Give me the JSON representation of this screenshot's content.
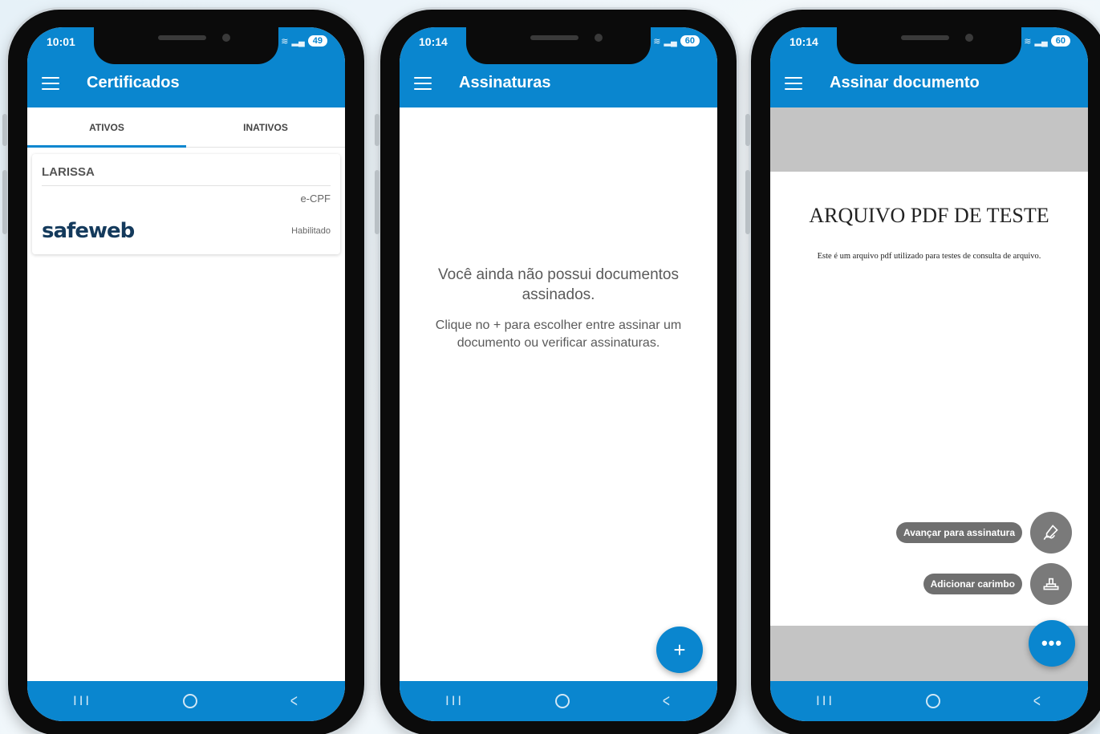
{
  "phones": [
    {
      "status_time": "10:01",
      "battery": "49",
      "title": "Certificados",
      "tabs": [
        "ATIVOS",
        "INATIVOS"
      ],
      "active_tab": "ATIVOS",
      "certificate": {
        "name": "LARISSA",
        "type": "e-CPF",
        "issuer_logo_text": "safeweb",
        "status": "Habilitado"
      }
    },
    {
      "status_time": "10:14",
      "battery": "60",
      "title": "Assinaturas",
      "empty_title": "Você ainda não possui documentos assinados.",
      "empty_hint": "Clique no + para escolher entre assinar um documento ou verificar assinaturas.",
      "fab_symbol": "+"
    },
    {
      "status_time": "10:14",
      "battery": "60",
      "title": "Assinar documento",
      "pdf_title": "ARQUIVO PDF DE TESTE",
      "pdf_body": "Este é um arquivo pdf utilizado para testes de consulta de arquivo.",
      "action_sign": "Avançar para assinatura",
      "action_stamp": "Adicionar carimbo",
      "fab_symbol": "•••"
    }
  ],
  "nav": {
    "recent": "III",
    "back": "<"
  },
  "colors": {
    "primary": "#0a86cf",
    "pdf_bg": "#c4c4c4",
    "speed_dial": "#6f6f6f"
  },
  "icons": [
    "menu-icon",
    "wifi-icon",
    "signal-icon",
    "battery-icon",
    "pen-icon",
    "stamp-icon",
    "add-icon",
    "more-icon"
  ]
}
